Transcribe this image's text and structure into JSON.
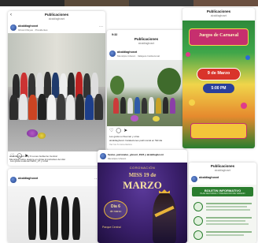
{
  "colors": {
    "accent": "#1d3e8a",
    "poster_green": "#2a7d2e",
    "poster_purple": "#3a1f6b",
    "gold": "#e8b43a"
  },
  "left_post": {
    "header_title": "Publicaciones",
    "header_sub": "alcaldiaghosnt",
    "account_name": "alcaldiaghosnt",
    "account_location": "Ghosnt Reyes · Presidentes",
    "liked_by": "Les gusta a alexerchalbz_27 y otras",
    "caption_1": "alcaldiaghosnt Hoy 6 Lunes Gobierno Central",
    "caption_2": "Municipal sobre avance en obras importantes del dist",
    "next_account": "alcaldiaghosnt"
  },
  "middle_post": {
    "header_title": "Publicaciones",
    "header_sub": "alcaldiaghosnt",
    "time": "9:32",
    "account_name": "alcaldiaghosnt",
    "account_location": "Municipio Ghosnt · Vallejera Institucional",
    "liked_by": "Les gusta a nhuemar y otras",
    "caption_1": "alcaldiaghosnt Instalaciones patrimonial en 5El dia",
    "caption_2": "Ver los 6 comentarios"
  },
  "right_post": {
    "header_title": "Publicaciones",
    "header_sub": "alcaldiaghosnt",
    "poster_title": "Juegos de Carnaval",
    "poster_date": "9 de Marzo",
    "poster_time": "5:00 PM"
  },
  "bottom_middle": {
    "account": "fiestas_patronales_ghosnt_2024 y alcaldiaghosnt",
    "account_sub": "Municipio Ghosnt",
    "poster_heading": "CORONACIÓN",
    "poster_title_1": "MISS 19 de",
    "poster_title_2": "MARZO",
    "poster_day": "Día 6",
    "poster_day_sub": "de marzo",
    "poster_place": "Parque Central"
  },
  "bottom_right": {
    "header_title": "Publicaciones",
    "header_sub": "alcaldiaghosnt",
    "account": "alcaldiaghosnt",
    "banner": "BOLETIN INFORMATIVO",
    "banner_sub": "PLAN DE PODAS Y PREVENCION DE VERANO"
  }
}
